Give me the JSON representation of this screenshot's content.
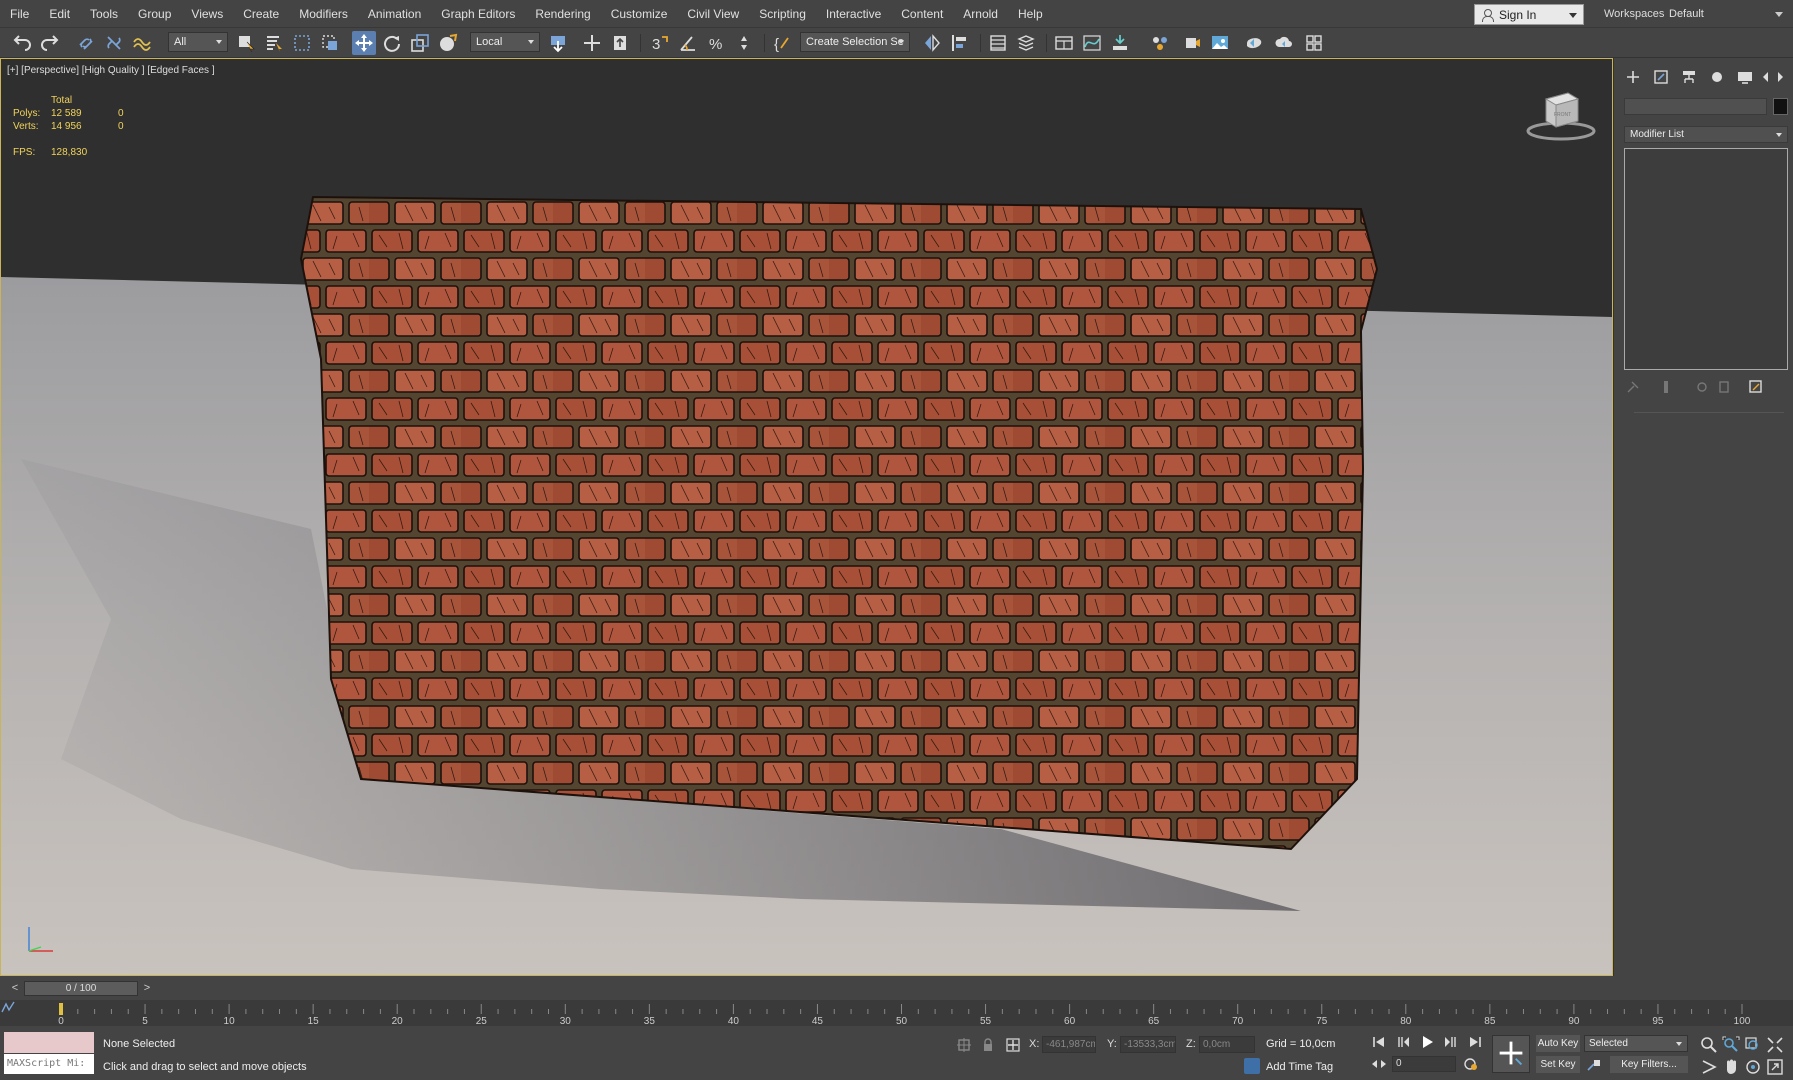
{
  "menu": [
    "File",
    "Edit",
    "Tools",
    "Group",
    "Views",
    "Create",
    "Modifiers",
    "Animation",
    "Graph Editors",
    "Rendering",
    "Customize",
    "Civil View",
    "Scripting",
    "Interactive",
    "Content",
    "Arnold",
    "Help"
  ],
  "account": {
    "sign_in": "Sign In",
    "workspaces_label": "Workspaces:",
    "workspace": "Default"
  },
  "toolbar": {
    "selection_filter": "All",
    "reference_coord": "Local",
    "named_selection": "Create Selection Se"
  },
  "viewport": {
    "label": "[+] [Perspective] [High Quality ] [Edged Faces ]",
    "stats": {
      "total_header": "Total",
      "polys_label": "Polys:",
      "polys_total": "12 589",
      "polys_sel": "0",
      "verts_label": "Verts:",
      "verts_total": "14 956",
      "verts_sel": "0",
      "fps_label": "FPS:",
      "fps_value": "128,830"
    },
    "viewcube_label": "FRONT",
    "colors": {
      "background": "#2f2f2f",
      "ground": "#b3b0ae",
      "brick": "#b2543b",
      "mortar": "#5a4a35",
      "border": "#c9b45a"
    }
  },
  "command_panel": {
    "modifier_list": "Modifier List"
  },
  "timeline": {
    "slider": "0 / 100",
    "prev": "<",
    "next": ">",
    "ticks": [
      "0",
      "5",
      "10",
      "15",
      "20",
      "25",
      "30",
      "35",
      "40",
      "45",
      "50",
      "55",
      "60",
      "65",
      "70",
      "75",
      "80",
      "85",
      "90",
      "95",
      "100"
    ]
  },
  "status": {
    "maxscript": "MAXScript Mi:",
    "selection": "None Selected",
    "prompt": "Click and drag to select and move objects",
    "x_label": "X:",
    "x_value": "-461,987cm",
    "y_label": "Y:",
    "y_value": "-13533,3cm",
    "z_label": "Z:",
    "z_value": "0,0cm",
    "grid": "Grid = 10,0cm",
    "add_time_tag": "Add Time Tag",
    "frame": "0",
    "auto_key": "Auto Key",
    "set_key": "Set Key",
    "key_mode": "Selected",
    "key_filters": "Key Filters..."
  }
}
